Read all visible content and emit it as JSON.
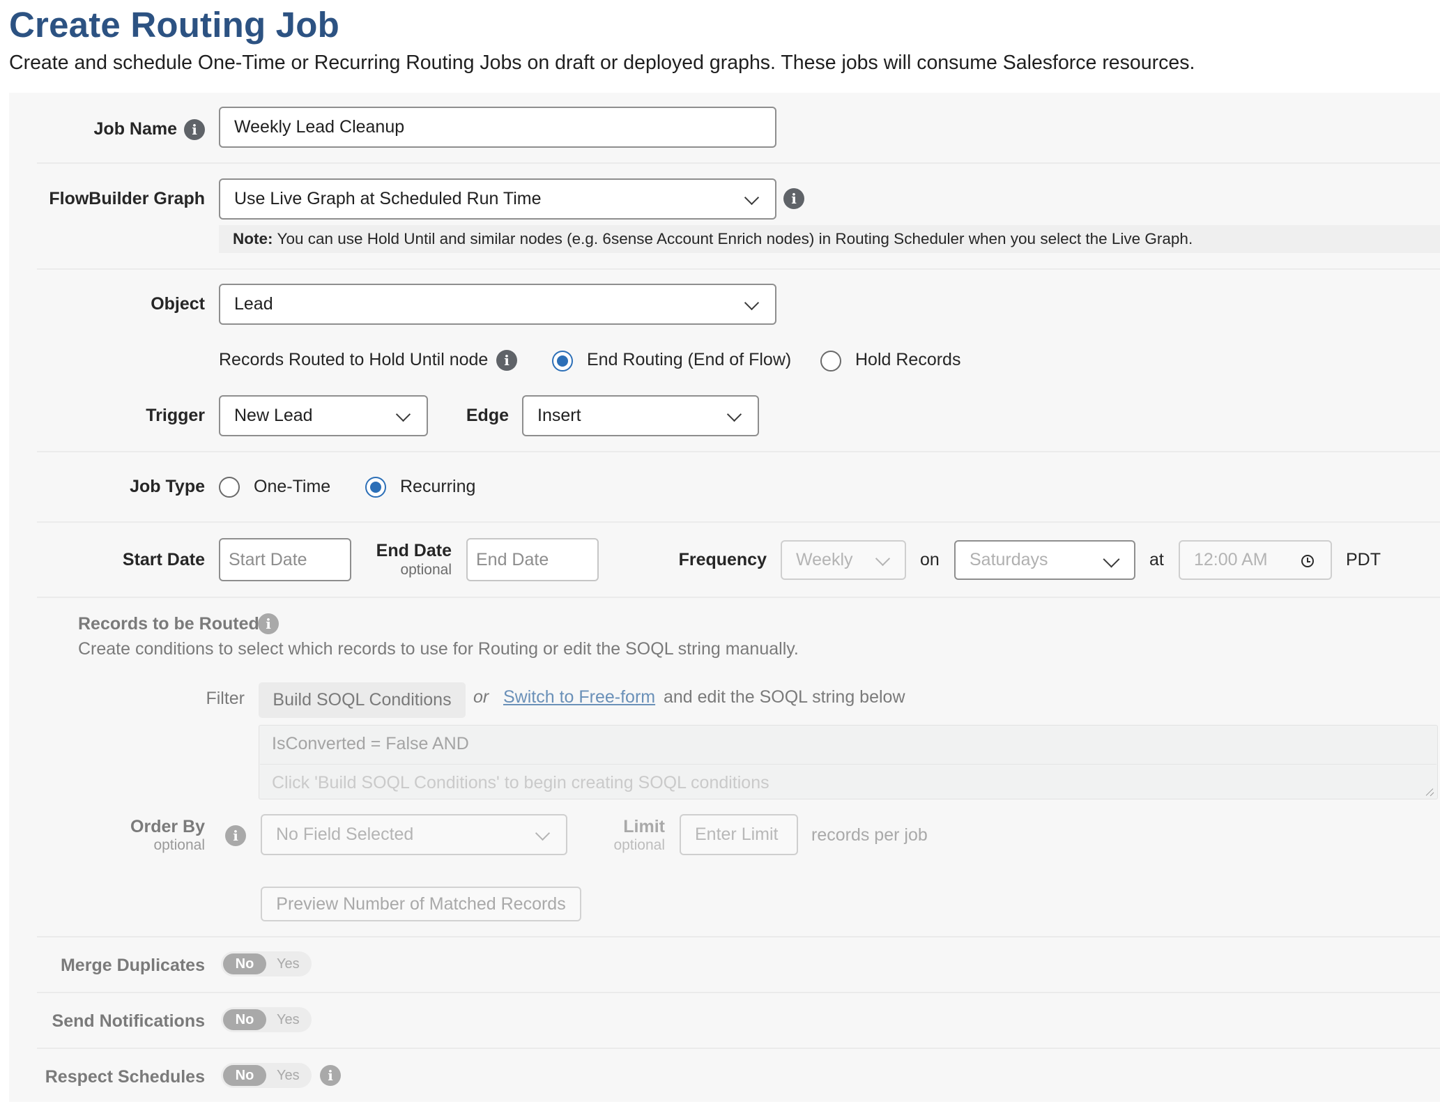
{
  "page": {
    "title": "Create Routing Job",
    "subtitle": "Create and schedule One-Time or Recurring Routing Jobs on draft or deployed graphs. These jobs will consume Salesforce resources."
  },
  "job_name": {
    "label": "Job Name",
    "value": "Weekly Lead Cleanup"
  },
  "flowbuilder": {
    "label": "FlowBuilder Graph",
    "selected": "Use Live Graph at Scheduled Run Time",
    "note_bold": "Note:",
    "note_text": "You can use Hold Until and similar nodes (e.g. 6sense Account Enrich nodes) in Routing Scheduler when you select the Live Graph."
  },
  "object": {
    "label": "Object",
    "selected": "Lead"
  },
  "hold_until": {
    "label": "Records Routed to Hold Until node",
    "options": [
      "End Routing (End of Flow)",
      "Hold Records"
    ],
    "selected": "End Routing (End of Flow)"
  },
  "trigger": {
    "label": "Trigger",
    "selected": "New Lead"
  },
  "edge": {
    "label": "Edge",
    "selected": "Insert"
  },
  "job_type": {
    "label": "Job Type",
    "options": [
      "One-Time",
      "Recurring"
    ],
    "selected": "Recurring"
  },
  "schedule": {
    "start_label": "Start Date",
    "start_placeholder": "Start Date",
    "end_label": "End Date",
    "end_sub": "optional",
    "end_placeholder": "End Date",
    "frequency_label": "Frequency",
    "frequency_value": "Weekly",
    "on_label": "on",
    "day_value": "Saturdays",
    "at_label": "at",
    "time_value": "12:00 AM",
    "timezone": "PDT"
  },
  "records": {
    "label": "Records to be Routed",
    "description": "Create conditions to select which records to use for Routing or edit the SOQL string manually.",
    "filter_label": "Filter",
    "build_button": "Build SOQL Conditions",
    "or_text": "or",
    "switch_link": "Switch to Free-form",
    "after_link": "and edit the SOQL string below",
    "soql_line": "IsConverted = False AND",
    "soql_placeholder": "Click 'Build SOQL Conditions' to begin creating SOQL conditions"
  },
  "order_by": {
    "label": "Order By",
    "sub": "optional",
    "placeholder": "No Field Selected"
  },
  "limit": {
    "label": "Limit",
    "sub": "optional",
    "placeholder": "Enter Limit",
    "suffix": "records per job"
  },
  "preview_button": "Preview Number of Matched Records",
  "toggles": [
    {
      "label": "Merge Duplicates",
      "off": "No",
      "on": "Yes",
      "value": "No"
    },
    {
      "label": "Send Notifications",
      "off": "No",
      "on": "Yes",
      "value": "No"
    },
    {
      "label": "Respect Schedules",
      "off": "No",
      "on": "Yes",
      "value": "No"
    }
  ],
  "icons": {
    "info": "info-icon",
    "chevron": "chevron-down-icon",
    "clock": "clock-icon"
  },
  "colors": {
    "title": "#2c5282",
    "radio_selected": "#2c6fb7",
    "link": "#6a90b8"
  }
}
